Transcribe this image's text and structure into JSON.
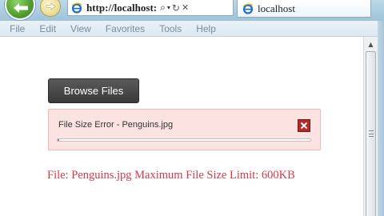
{
  "browser": {
    "address": "http://localhost:",
    "tab_title": "localhost"
  },
  "menu": {
    "items": [
      "File",
      "Edit",
      "View",
      "Favorites",
      "Tools",
      "Help"
    ]
  },
  "page": {
    "browse_button_label": "Browse Files",
    "file_item": {
      "status_text": "File Size Error - Penguins.jpg",
      "progress_fraction": 0.0
    },
    "error_message": "File: Penguins.jpg Maximum File Size Limit: 600KB"
  },
  "colors": {
    "error_text": "#d43a4a",
    "error_box_bg": "#fbe3e1",
    "button_bg": "#444444",
    "remove_icon": "#b42a2a"
  },
  "icons": {
    "back": "back-arrow-icon",
    "forward": "forward-arrow-icon",
    "site": "ie-logo-icon",
    "search": "search-icon",
    "dropdown": "chevron-down-icon",
    "refresh": "refresh-icon",
    "stop": "stop-icon",
    "remove": "close-icon"
  }
}
